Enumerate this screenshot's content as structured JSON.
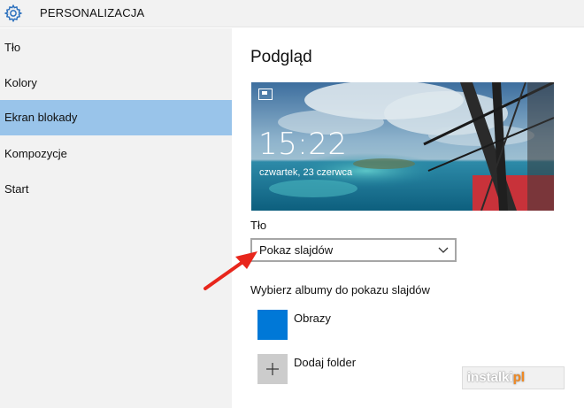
{
  "header": {
    "title": "PERSONALIZACJA",
    "icon": "gear-icon"
  },
  "sidebar": {
    "items": [
      {
        "label": "Tło",
        "active": false
      },
      {
        "label": "Kolory",
        "active": false
      },
      {
        "label": "Ekran blokady",
        "active": true
      },
      {
        "label": "Kompozycje",
        "active": false
      },
      {
        "label": "Start",
        "active": false
      }
    ],
    "active_color": "#99c4ea"
  },
  "main": {
    "preview_title": "Podgląd",
    "preview": {
      "time": "15:22",
      "date": "czwartek, 23 czerwca",
      "icon": "slideshow-icon"
    },
    "background_label": "Tło",
    "background_value": "Pokaz slajdów",
    "albums_label": "Wybierz albumy do pokazu slajdów",
    "albums": [
      {
        "name": "Obrazy",
        "color": "#0078d7"
      }
    ],
    "add_folder_label": "Dodaj folder"
  },
  "watermark": {
    "text_main": "instalki",
    "text_accent": "pl"
  },
  "annotation": {
    "arrow_color": "#e8261c"
  }
}
